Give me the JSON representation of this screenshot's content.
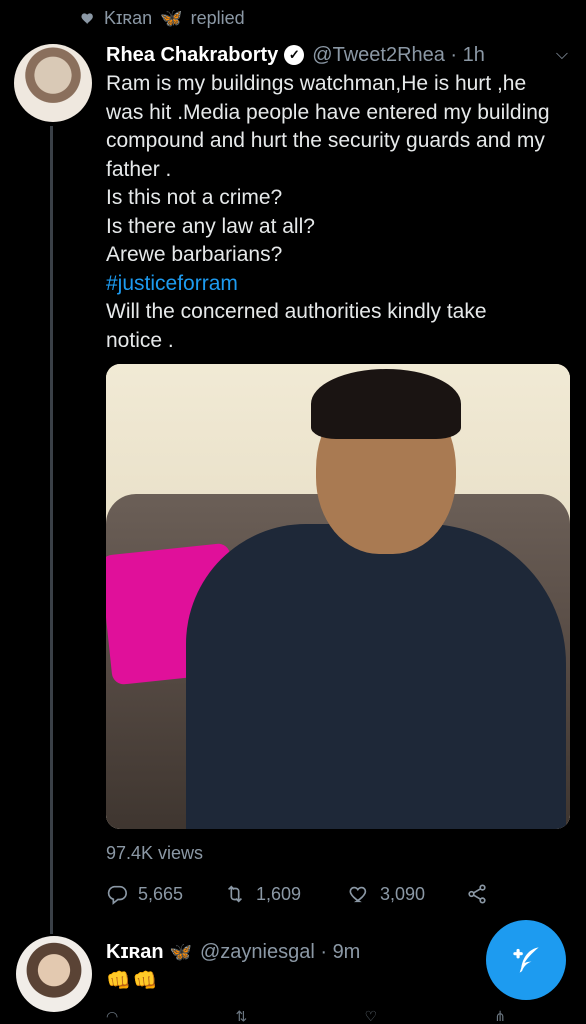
{
  "replied_row": {
    "user": "Kɪʀan",
    "butterfly": "🦋",
    "label": "replied"
  },
  "tweet": {
    "author_name": "Rhea Chakraborty",
    "handle": "@Tweet2Rhea · 1h",
    "lines": [
      "Ram is my buildings watchman,He is hurt ,he",
      "was hit .Media people have entered my building",
      "compound and hurt the security guards and my",
      "father .",
      "Is this not a crime?",
      "Is there any law at all?",
      "Arewe barbarians?"
    ],
    "hashtag": "#justiceforram",
    "tail_lines": [
      "Will the concerned authorities kindly take",
      "notice ."
    ],
    "views": "97.4K views",
    "reply_count": "5,665",
    "retweet_count": "1,609",
    "like_count": "3,090"
  },
  "reply": {
    "author_name": "Kɪʀan",
    "butterfly": "🦋",
    "handle": "@zayniesgal · 9m",
    "text": "👊👊"
  },
  "colors": {
    "accent": "#1d9bf0",
    "background": "#000000",
    "muted": "#8b98a5"
  },
  "icons": [
    "heart-icon",
    "verified-icon",
    "chevron-down-icon",
    "reply-icon",
    "retweet-icon",
    "like-icon",
    "share-icon",
    "compose-icon"
  ]
}
